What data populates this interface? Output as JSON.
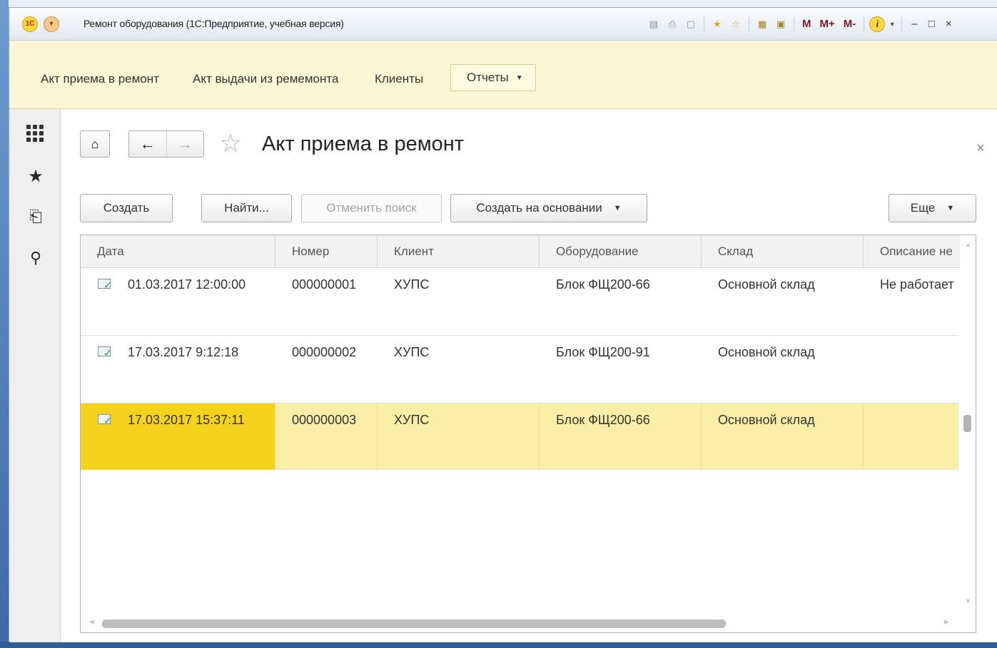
{
  "window": {
    "title": "Ремонт оборудования  (1С:Предприятие, учебная версия)",
    "logo_text": "1С",
    "toolbar": {
      "m": "M",
      "mplus": "M+",
      "mminus": "M-",
      "info": "i",
      "minimize": "–",
      "maximize": "□",
      "close": "×"
    }
  },
  "sections": {
    "items": [
      "Акт приема в ремонт",
      "Акт выдачи из ремемонта",
      "Клиенты"
    ],
    "reports_label": "Отчеты"
  },
  "page": {
    "title": "Акт приема в ремонт",
    "close": "×"
  },
  "commands": {
    "create": "Создать",
    "find": "Найти...",
    "cancel_search": "Отменить поиск",
    "create_based_on": "Создать на основании",
    "more": "Еще"
  },
  "table": {
    "columns": [
      "Дата",
      "Номер",
      "Клиент",
      "Оборудование",
      "Склад",
      "Описание не"
    ],
    "rows": [
      {
        "date": "01.03.2017 12:00:00",
        "number": "000000001",
        "client": "ХУПС",
        "equipment": "Блок ФЩ200-66",
        "warehouse": "Основной склад",
        "description": "Не работает"
      },
      {
        "date": "17.03.2017 9:12:18",
        "number": "000000002",
        "client": "ХУПС",
        "equipment": "Блок ФЩ200-91",
        "warehouse": "Основной склад",
        "description": ""
      },
      {
        "date": "17.03.2017 15:37:11",
        "number": "000000003",
        "client": "ХУПС",
        "equipment": "Блок ФЩ200-66",
        "warehouse": "Основной склад",
        "description": ""
      }
    ],
    "selected_row": 2
  }
}
